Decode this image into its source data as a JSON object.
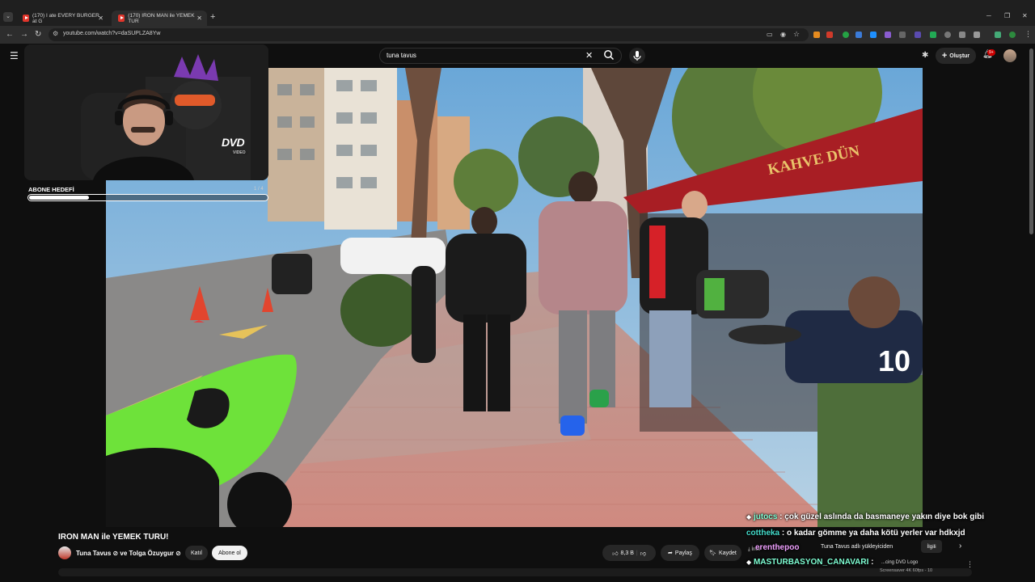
{
  "browser": {
    "tabs": [
      {
        "label": "(170) I ate EVERY BURGER at G"
      },
      {
        "label": "(170) IRON MAN ile YEMEK TUR"
      }
    ],
    "url": "youtube.com/watch?v=daSUPLZA8Yw"
  },
  "youtube": {
    "search_value": "tuna tavus",
    "create_label": "Oluştur",
    "notification_count": "9+"
  },
  "overlay": {
    "goal_label": "ABONE HEDEFİ",
    "goal_count": "1 / 4",
    "goal_progress": 0.25,
    "dvd_logo": "DVD",
    "dvd_sub": "VIDEO"
  },
  "video": {
    "title": "IRON MAN ile YEMEK TURU!",
    "channels": "Tuna Tavus ⊘ ve Tolga Özuygur ⊘",
    "join_label": "Katıl",
    "subscribe_label": "Abone ol",
    "likes": "8,3 B",
    "share_label": "Paylaş",
    "save_label": "Kaydet",
    "storefront_sign": "KAHVE DÜN",
    "jersey_number": "10"
  },
  "sidebar": {
    "install_label": "İndir",
    "uploader_chip": "Tuna Tavus adlı yükleyiciden",
    "related_chip": "İlgili",
    "reco_title": "...cing DVD Logo",
    "reco_sub": "Screensaver 4K 60fps - 10"
  },
  "chat": [
    {
      "nick": "jutocs",
      "text": " : çok güzel aslında da basmaneye yakın diye bok gibi"
    },
    {
      "nick": "cottheka",
      "text": " : o kadar gömme ya daha kötü yerler var hdkxjd"
    },
    {
      "nick": "erenthepoo",
      "text": ""
    },
    {
      "nick": "MASTURBASYON_CANAVARI",
      "text": " :"
    }
  ]
}
